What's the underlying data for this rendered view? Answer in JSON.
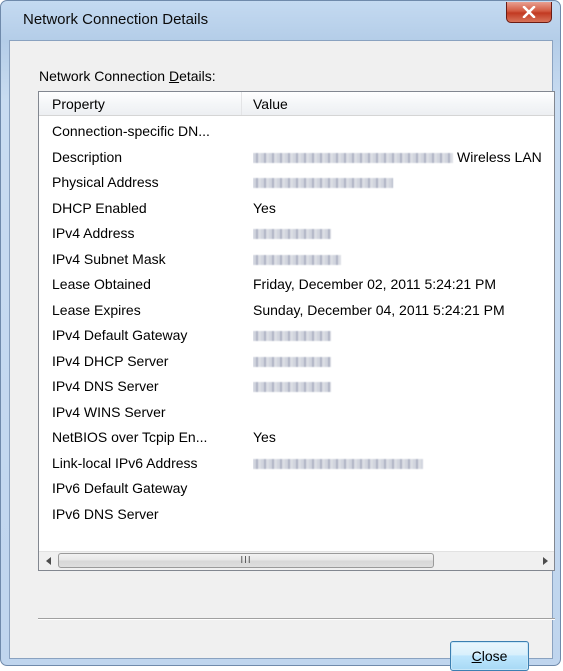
{
  "window": {
    "title": "Network Connection Details",
    "close_glyph": "X"
  },
  "group_label": {
    "prefix": "Network Connection ",
    "access_key": "D",
    "suffix": "etails:"
  },
  "table": {
    "columns": [
      "Property",
      "Value"
    ],
    "rows": [
      {
        "property": "Connection-specific DN...",
        "value": ""
      },
      {
        "property": "Description",
        "value": "Wireless LAN",
        "redacted": true
      },
      {
        "property": "Physical Address",
        "value": "",
        "redacted": true
      },
      {
        "property": "DHCP Enabled",
        "value": "Yes"
      },
      {
        "property": "IPv4 Address",
        "value": "",
        "redacted": true
      },
      {
        "property": "IPv4 Subnet Mask",
        "value": "",
        "redacted": true
      },
      {
        "property": "Lease Obtained",
        "value": "Friday, December 02, 2011 5:24:21 PM"
      },
      {
        "property": "Lease Expires",
        "value": "Sunday, December 04, 2011 5:24:21 PM"
      },
      {
        "property": "IPv4 Default Gateway",
        "value": "",
        "redacted": true
      },
      {
        "property": "IPv4 DHCP Server",
        "value": "",
        "redacted": true
      },
      {
        "property": "IPv4 DNS Server",
        "value": "",
        "redacted": true
      },
      {
        "property": "IPv4 WINS Server",
        "value": ""
      },
      {
        "property": "NetBIOS over Tcpip En...",
        "value": "Yes"
      },
      {
        "property": "Link-local IPv6 Address",
        "value": "",
        "redacted": true
      },
      {
        "property": "IPv6 Default Gateway",
        "value": ""
      },
      {
        "property": "IPv6 DNS Server",
        "value": ""
      }
    ]
  },
  "scrollbar": {
    "thumb_grip": "III"
  },
  "buttons": {
    "close_access_key": "C",
    "close_rest": "lose"
  },
  "colors": {
    "title_bar": "#bfd5ee",
    "close_red": "#c23a22",
    "button_blue": "#a7d9f5"
  }
}
